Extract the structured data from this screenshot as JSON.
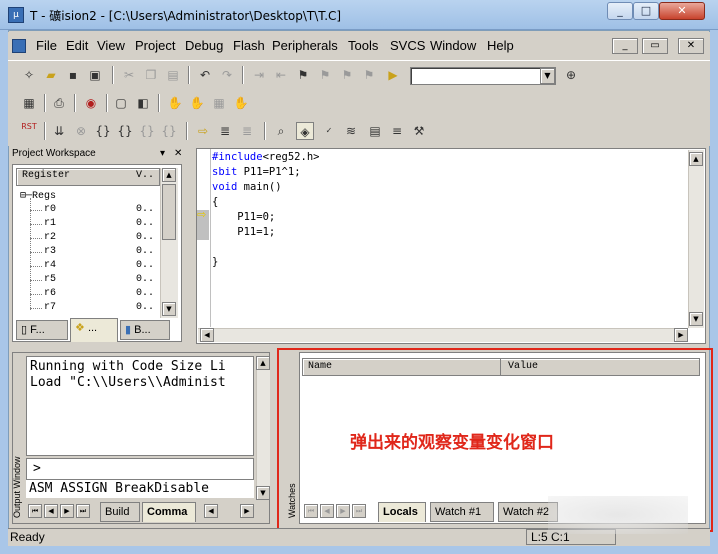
{
  "window": {
    "title": "T  - 礦ision2 - [C:\\Users\\Administrator\\Desktop\\T\\T.C]",
    "app_icon": "uvision-icon",
    "caption_buttons": [
      "_",
      "□",
      "✕"
    ]
  },
  "menu": {
    "items": [
      "File",
      "Edit",
      "View",
      "Project",
      "Debug",
      "Flash",
      "Peripherals",
      "Tools",
      "SVCS",
      "Window",
      "Help"
    ],
    "mdi_buttons": [
      "_",
      "▭",
      "✕"
    ]
  },
  "toolbar": {
    "find_combo_value": "",
    "icons": [
      "new-file-icon",
      "open-icon",
      "save-icon",
      "save-all-icon",
      "cut-icon",
      "copy-icon",
      "paste-icon",
      "undo-icon",
      "redo-icon",
      "indent-icon",
      "unindent-icon",
      "bookmark-icon",
      "find-icon",
      "binoculars-icon",
      "rst-icon",
      "step-icon",
      "stop-icon",
      "run-icon",
      "breakpoint-icon",
      "memory-icon",
      "hammer-icon"
    ],
    "rst_label": "RST"
  },
  "workspace": {
    "title": "Project Workspace",
    "columns": [
      "Register",
      "V.."
    ],
    "root": "Regs",
    "registers": [
      {
        "name": "r0",
        "value": "0.."
      },
      {
        "name": "r1",
        "value": "0.."
      },
      {
        "name": "r2",
        "value": "0.."
      },
      {
        "name": "r3",
        "value": "0.."
      },
      {
        "name": "r4",
        "value": "0.."
      },
      {
        "name": "r5",
        "value": "0.."
      },
      {
        "name": "r6",
        "value": "0.."
      },
      {
        "name": "r7",
        "value": "0.."
      }
    ],
    "tabs": [
      "F...",
      "...",
      "B..."
    ]
  },
  "editor": {
    "lines": [
      {
        "pre": "#include",
        "rest": "<reg52.h>"
      },
      {
        "pre": "sbit",
        "rest": " P11=P1^1;"
      },
      {
        "pre": "void",
        "rest": " main()"
      },
      {
        "pre": "",
        "rest": "{"
      },
      {
        "pre": "",
        "rest": "    P11=0;"
      },
      {
        "pre": "",
        "rest": "    P11=1;"
      },
      {
        "pre": "",
        "rest": ""
      },
      {
        "pre": "",
        "rest": "}"
      }
    ]
  },
  "output": {
    "label": "Output Window",
    "lines": [
      "Running with Code Size Li",
      "Load \"C:\\\\Users\\\\Administ"
    ],
    "prompt": ">",
    "command_line": "ASM ASSIGN BreakDisable",
    "tabs": [
      "Build",
      "Comma"
    ]
  },
  "watches": {
    "label": "Watches",
    "columns": [
      "Name",
      "Value"
    ],
    "annotation": "弹出来的观察变量变化窗口",
    "tabs": [
      "Locals",
      "Watch #1",
      "Watch #2"
    ]
  },
  "status": {
    "left": "Ready",
    "right": "L:5 C:1"
  }
}
